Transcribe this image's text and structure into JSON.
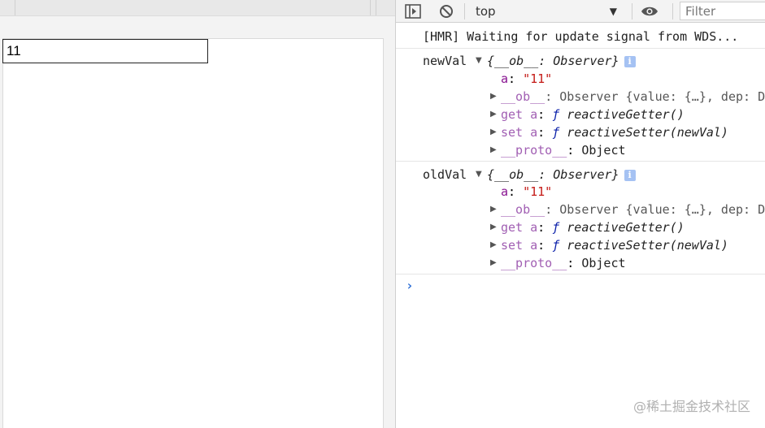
{
  "page": {
    "input_value": "11"
  },
  "toolbar": {
    "context": "top",
    "filter_placeholder": "Filter"
  },
  "console": {
    "hmr_message": "[HMR] Waiting for update signal from WDS...",
    "logs": [
      {
        "label": "newVal",
        "summary": "{__ob__: Observer}",
        "prop_key": "a",
        "prop_value": "\"11\"",
        "ob_key": "__ob__",
        "ob_value": "Observer {value: {…}, dep: D",
        "getter_key": "get a",
        "getter_value": "reactiveGetter()",
        "setter_key": "set a",
        "setter_value": "reactiveSetter(newVal)",
        "proto_key": "__proto__",
        "proto_value": "Object"
      },
      {
        "label": "oldVal",
        "summary": "{__ob__: Observer}",
        "prop_key": "a",
        "prop_value": "\"11\"",
        "ob_key": "__ob__",
        "ob_value": "Observer {value: {…}, dep: D",
        "getter_key": "get a",
        "getter_value": "reactiveGetter()",
        "setter_key": "set a",
        "setter_value": "reactiveSetter(newVal)",
        "proto_key": "__proto__",
        "proto_value": "Object"
      }
    ],
    "fn_symbol": "ƒ",
    "info_glyph": "i",
    "prompt_glyph": "›"
  },
  "watermark": "@稀土掘金技术社区",
  "colors": {
    "accent": "#2c6ed6",
    "property": "#881391",
    "string": "#c41a16",
    "function": "#0d22aa"
  }
}
